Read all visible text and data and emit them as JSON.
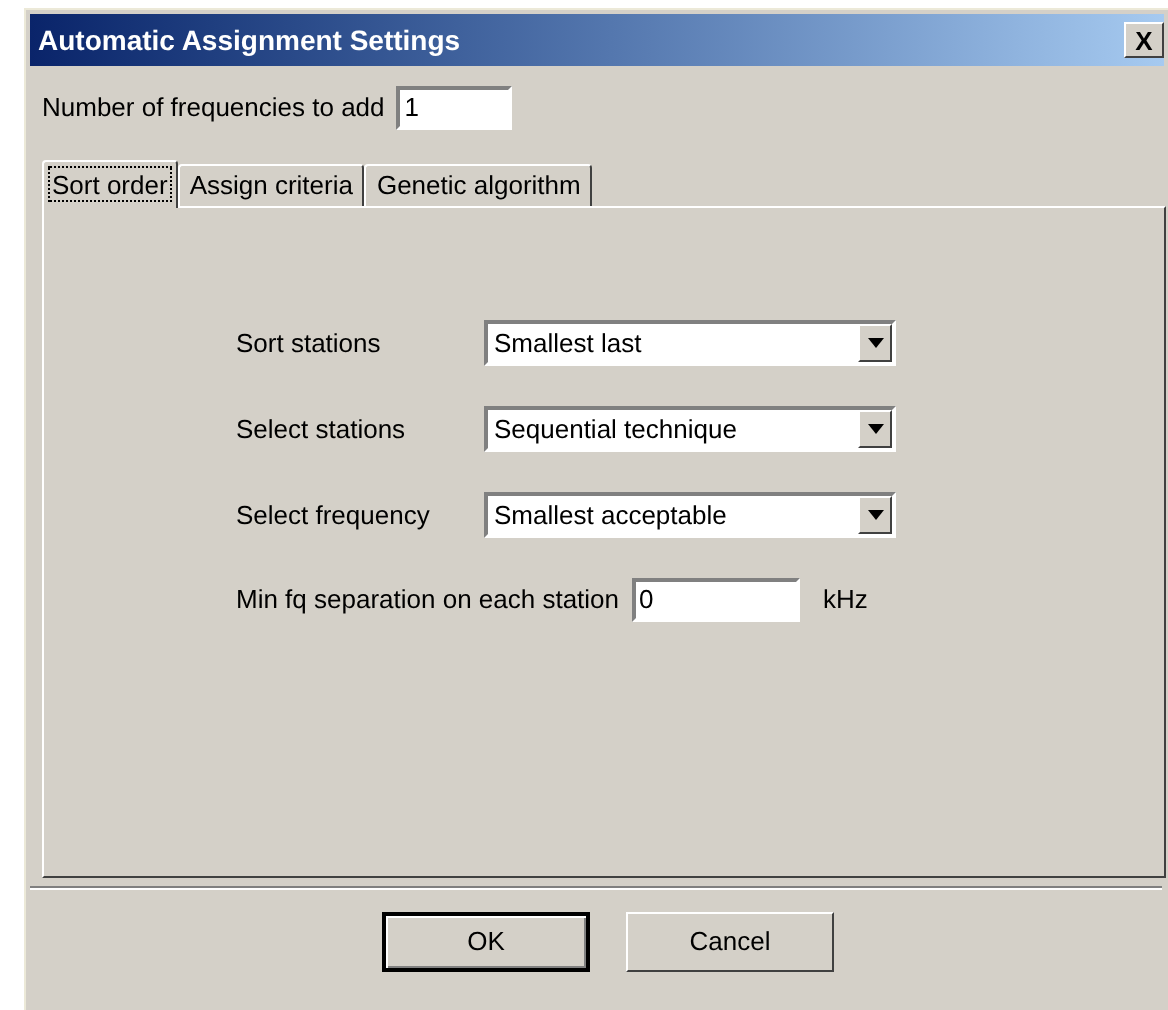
{
  "window": {
    "title": "Automatic Assignment Settings",
    "close": "X"
  },
  "count_field": {
    "label": "Number of frequencies to add",
    "value": "1"
  },
  "tabs": [
    {
      "label": "Sort order",
      "selected": true
    },
    {
      "label": "Assign criteria",
      "selected": false
    },
    {
      "label": "Genetic algorithm",
      "selected": false
    }
  ],
  "selects": [
    {
      "label": "Sort stations",
      "value": "Smallest last"
    },
    {
      "label": "Select stations",
      "value": "Sequential technique"
    },
    {
      "label": "Select frequency",
      "value": "Smallest acceptable"
    }
  ],
  "separation_field": {
    "label": "Min fq separation on each station",
    "value": "0",
    "unit": "kHz"
  },
  "buttons": [
    {
      "label": "OK",
      "default": true
    },
    {
      "label": "Cancel",
      "default": false
    }
  ]
}
